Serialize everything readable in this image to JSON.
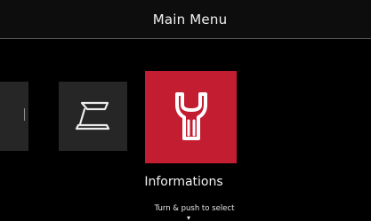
{
  "header": {
    "title": "Main Menu"
  },
  "menu": {
    "items": [
      {
        "icon": "partial-menu-icon",
        "selected": false
      },
      {
        "icon": "welding-torch-icon",
        "selected": false
      },
      {
        "icon": "wrench-icon",
        "selected": true
      }
    ],
    "selected_label": "Informations"
  },
  "footer": {
    "hint": "Turn & push to select",
    "indicator": "▾"
  },
  "colors": {
    "background": "#000000",
    "tile": "#262626",
    "accent": "#c31d31",
    "text": "#f2f2f2"
  }
}
